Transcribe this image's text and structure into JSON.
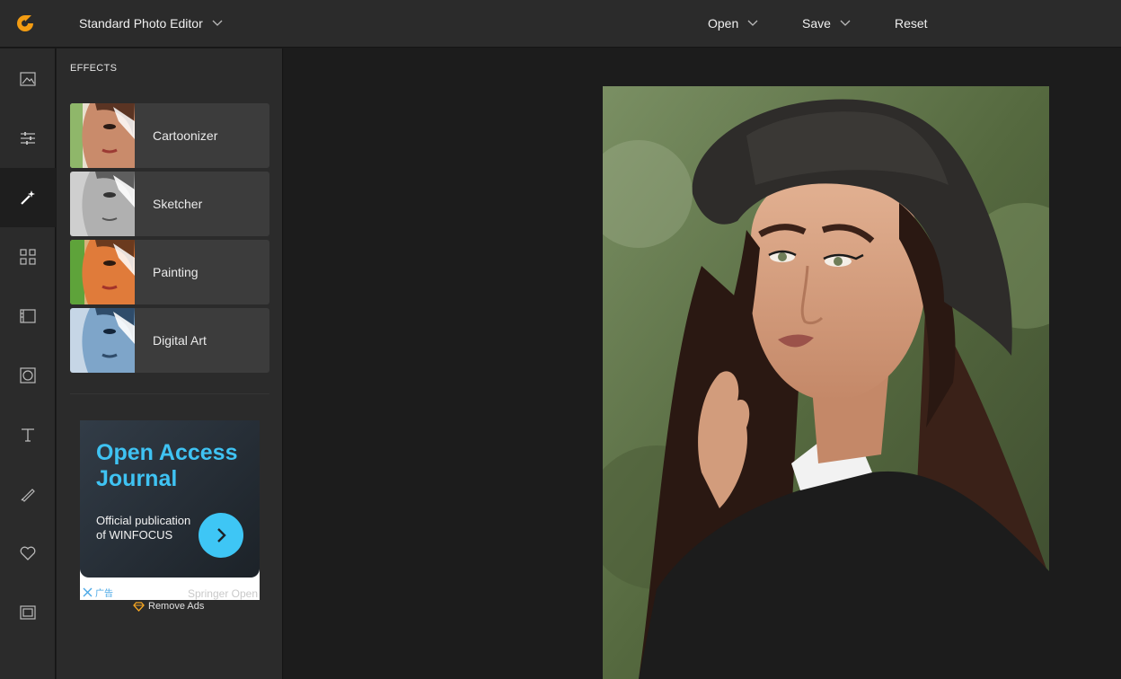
{
  "app": {
    "title": "Standard Photo Editor",
    "accent": "#f39c12"
  },
  "menu": {
    "open": "Open",
    "save": "Save",
    "reset": "Reset"
  },
  "tools": [
    {
      "name": "image-icon"
    },
    {
      "name": "adjust-sliders-icon"
    },
    {
      "name": "magic-wand-icon",
      "active": true
    },
    {
      "name": "grid-icon"
    },
    {
      "name": "frame-icon"
    },
    {
      "name": "vignette-icon"
    },
    {
      "name": "text-icon"
    },
    {
      "name": "brush-icon"
    },
    {
      "name": "heart-icon"
    },
    {
      "name": "border-icon"
    }
  ],
  "panel": {
    "title": "EFFECTS",
    "effects": [
      {
        "label": "Cartoonizer"
      },
      {
        "label": "Sketcher"
      },
      {
        "label": "Painting"
      },
      {
        "label": "Digital Art"
      }
    ]
  },
  "ad": {
    "title": "Open Access Journal",
    "subtitle": "Official publication of WINFOCUS",
    "close_text": "广告",
    "source": "Springer Open",
    "remove_ads": "Remove Ads"
  }
}
